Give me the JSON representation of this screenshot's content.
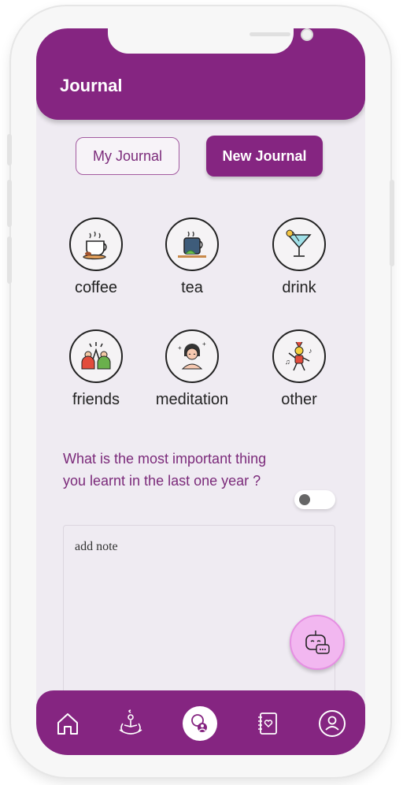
{
  "header": {
    "title": "Journal"
  },
  "tabs": {
    "my_journal": "My Journal",
    "new_journal": "New Journal"
  },
  "categories": [
    {
      "label": "coffee",
      "icon": "coffee-cup-icon"
    },
    {
      "label": "tea",
      "icon": "tea-cup-icon"
    },
    {
      "label": "drink",
      "icon": "cocktail-icon"
    },
    {
      "label": "friends",
      "icon": "friends-icon"
    },
    {
      "label": "meditation",
      "icon": "meditation-icon"
    },
    {
      "label": "other",
      "icon": "dancing-person-icon"
    }
  ],
  "question": {
    "text": "What is the most important thing you learnt in the last one year ?"
  },
  "note": {
    "placeholder": "add note"
  },
  "nav": {
    "items": [
      "home-icon",
      "lotus-meditation-icon",
      "chat-profile-icon",
      "journal-notebook-icon",
      "user-profile-icon"
    ]
  },
  "colors": {
    "primary": "#852581",
    "background": "#efebf2",
    "accent_text": "#7b2a7a",
    "fab": "#f2b7f0"
  }
}
